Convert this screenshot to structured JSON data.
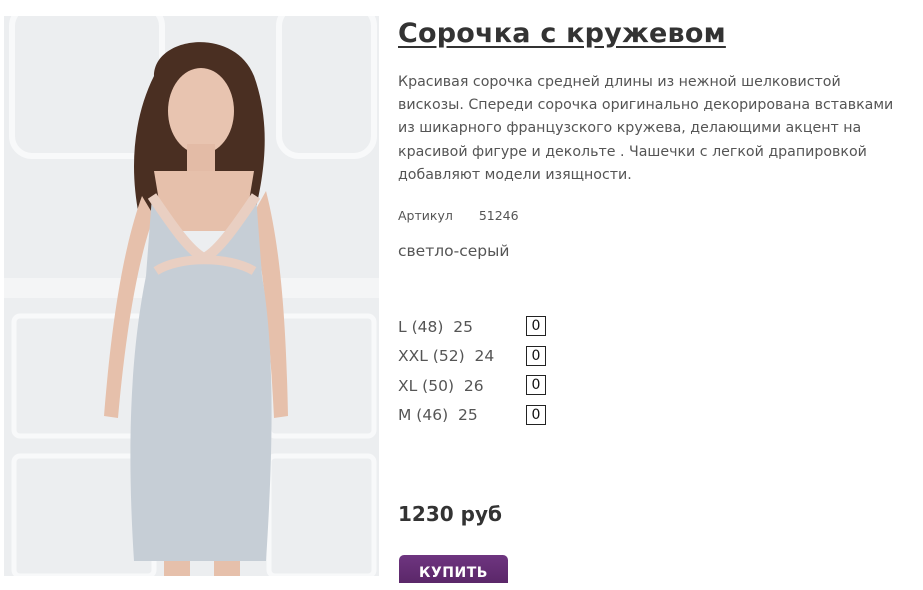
{
  "product": {
    "title": "Сорочка с кружевом",
    "description": "Красивая сорочка средней длины из нежной шелковистой вискозы. Спереди сорочка оригинально декорирована вставками из шикарного французского кружева, делающими акцент на красивой фигуре и декольте . Чашечки с легкой драпировкой добавляют модели изящности.",
    "sku_label": "Артикул",
    "sku_value": "51246",
    "color": "светло-серый",
    "image_icon": "product-photo",
    "sizes": [
      {
        "label": "L (48)  25",
        "qty": "0"
      },
      {
        "label": "XXL (52)  24",
        "qty": "0"
      },
      {
        "label": "XL (50)  26",
        "qty": "0"
      },
      {
        "label": "M (46)  25",
        "qty": "0"
      }
    ],
    "price": "1230 руб",
    "buy_label": "КУПИТЬ"
  },
  "colors": {
    "buy_button": "#5f2a6e",
    "title": "#333333"
  }
}
